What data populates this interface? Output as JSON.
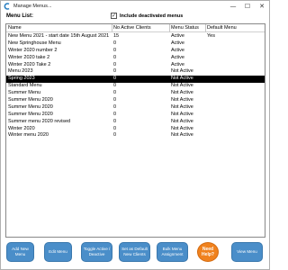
{
  "window": {
    "title": "Manage Menus...",
    "controls": {
      "minimize": "—",
      "maximize": "☐",
      "close": "✕"
    }
  },
  "menu_list_label": "Menu List:",
  "include_deactivated": {
    "label": "Include deactivated menus",
    "checked": true,
    "check_glyph": "✓"
  },
  "table": {
    "columns": [
      "Name",
      "No Active Clients",
      "Menu Status",
      "Default Menu"
    ],
    "rows": [
      {
        "name": "New Menu 2021 - start date 15th August 2021",
        "clients": "15",
        "status": "Active",
        "default": "Yes",
        "selected": false
      },
      {
        "name": "New Springhouse Menu",
        "clients": "0",
        "status": "Active",
        "default": "",
        "selected": false
      },
      {
        "name": "Winter 2020 number 2",
        "clients": "0",
        "status": "Active",
        "default": "",
        "selected": false
      },
      {
        "name": "Winter 2020 take 2",
        "clients": "0",
        "status": "Active",
        "default": "",
        "selected": false
      },
      {
        "name": "Winter 2020 Take 2",
        "clients": "0",
        "status": "Active",
        "default": "",
        "selected": false
      },
      {
        "name": "Menu 2023",
        "clients": "0",
        "status": "Not Active",
        "default": "",
        "selected": false
      },
      {
        "name": "Spring 2023",
        "clients": "0",
        "status": "Not Active",
        "default": "",
        "selected": true
      },
      {
        "name": "Standard Menu",
        "clients": "0",
        "status": "Not Active",
        "default": "",
        "selected": false
      },
      {
        "name": "Summer Menu",
        "clients": "0",
        "status": "Not Active",
        "default": "",
        "selected": false
      },
      {
        "name": "Summer Menu 2020",
        "clients": "0",
        "status": "Not Active",
        "default": "",
        "selected": false
      },
      {
        "name": "Summer Menu 2020",
        "clients": "0",
        "status": "Not Active",
        "default": "",
        "selected": false
      },
      {
        "name": "Summer Menu 2020",
        "clients": "0",
        "status": "Not Active",
        "default": "",
        "selected": false
      },
      {
        "name": "Summer menu 2020 revised",
        "clients": "0",
        "status": "Not Active",
        "default": "",
        "selected": false
      },
      {
        "name": "Winter 2020",
        "clients": "0",
        "status": "Not Active",
        "default": "",
        "selected": false
      },
      {
        "name": "Winter menu 2020",
        "clients": "0",
        "status": "Not Active",
        "default": "",
        "selected": false
      }
    ]
  },
  "buttons": {
    "add_new_menu": "Add New Menu",
    "edit_menu": "Edit Menu",
    "toggle_active": "Toggle Active / Deactive",
    "set_default": "Set as Default New Clients",
    "bulk_assignment": "Bulk Menu Assignment",
    "need_help": "Need Help?",
    "view_menu": "View Menu"
  },
  "colors": {
    "button_blue": "#4a8ec9",
    "help_orange": "#f0821e",
    "selected_row": "#000000"
  }
}
